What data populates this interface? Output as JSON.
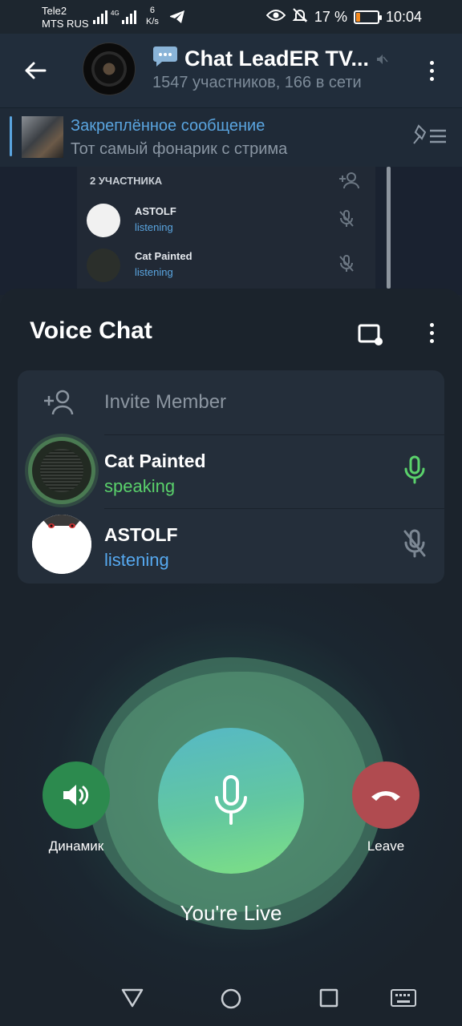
{
  "status_bar": {
    "carrier1": "Tele2",
    "carrier2": "MTS RUS",
    "speed_value": "6",
    "speed_unit": "K/s",
    "battery_percent": "17 %",
    "battery_level": 0.17,
    "time": "10:04"
  },
  "header": {
    "chat_title": "Chat LeadER TV...",
    "subtitle": "1547 участников, 166 в сети"
  },
  "pinned": {
    "title": "Закреплённое сообщение",
    "text": "Тот самый фонарик с стрима"
  },
  "background_preview": {
    "participants_count_label": "2 УЧАСТНИКА",
    "rows": [
      {
        "name": "ASTOLF",
        "status": "listening"
      },
      {
        "name": "Cat Painted",
        "status": "listening"
      }
    ]
  },
  "voice_chat": {
    "title": "Voice Chat",
    "invite_label": "Invite Member",
    "participants": [
      {
        "name": "Cat Painted",
        "status": "speaking",
        "mic": "active"
      },
      {
        "name": "ASTOLF",
        "status": "listening",
        "mic": "muted"
      }
    ],
    "speaker_label": "Динамик",
    "leave_label": "Leave",
    "live_label": "You're Live"
  },
  "colors": {
    "accent_blue": "#5aa5e0",
    "speaking_green": "#5ad16b",
    "leave_red": "#b04b50",
    "speaker_green": "#2c8a4e"
  }
}
